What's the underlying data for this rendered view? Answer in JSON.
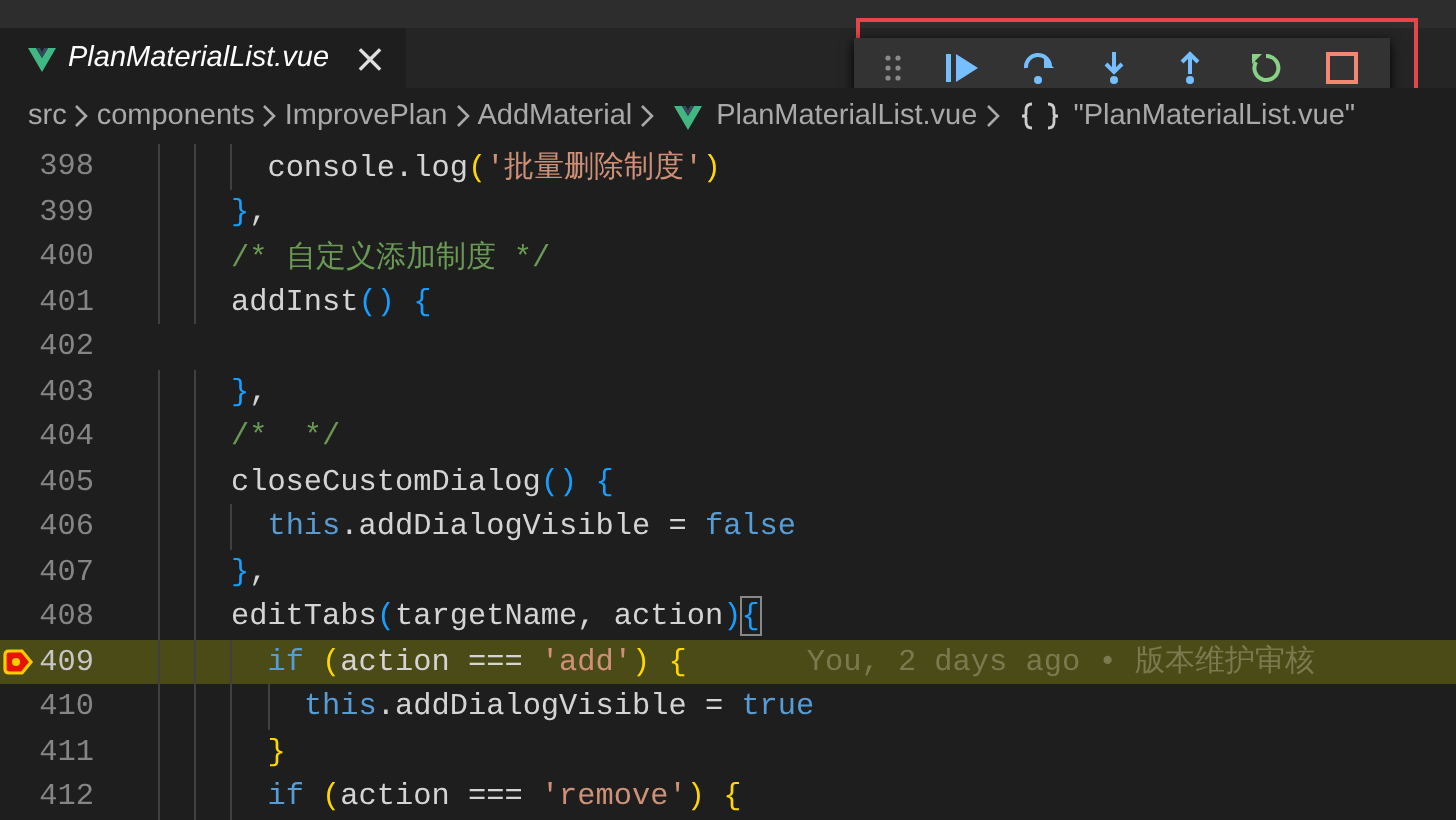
{
  "tabs": [
    {
      "label": "PlanMaterialList.vue",
      "selected": true,
      "preview": true,
      "close": "×"
    }
  ],
  "debug_toolbar": {
    "buttons": [
      {
        "kind": "gripper"
      },
      {
        "kind": "continue"
      },
      {
        "kind": "step_over"
      },
      {
        "kind": "step_into"
      },
      {
        "kind": "step_out"
      },
      {
        "kind": "restart"
      },
      {
        "kind": "stop"
      }
    ],
    "highlighted": true
  },
  "breadcrumbs": [
    {
      "kind": "folder",
      "label": "src"
    },
    {
      "kind": "folder",
      "label": "components"
    },
    {
      "kind": "folder",
      "label": "ImprovePlan"
    },
    {
      "kind": "folder",
      "label": "AddMaterial"
    },
    {
      "kind": "file",
      "label": "PlanMaterialList.vue"
    },
    {
      "kind": "symbol",
      "label": "\"PlanMaterialList.vue\""
    }
  ],
  "editor": {
    "lines": [
      {
        "number": "398",
        "tokens": [
          {
            "kind": "plain",
            "text": "      console.log"
          },
          {
            "kind": "bracket_gold",
            "text": "("
          },
          {
            "kind": "string",
            "text": "'批量删除制度'"
          },
          {
            "kind": "bracket_gold",
            "text": ")"
          }
        ]
      },
      {
        "number": "399",
        "tokens": [
          {
            "kind": "bracket_blue",
            "text": "    }"
          },
          {
            "kind": "plain",
            "text": ","
          }
        ]
      },
      {
        "number": "400",
        "tokens": [
          {
            "kind": "comment",
            "text": "    /* 自定义添加制度 */"
          }
        ]
      },
      {
        "number": "401",
        "tokens": [
          {
            "kind": "plain",
            "text": "    addInst"
          },
          {
            "kind": "bracket_blue",
            "text": "()"
          },
          {
            "kind": "bracket_blue",
            "text": " {"
          }
        ]
      },
      {
        "number": "402"
      },
      {
        "number": "403",
        "tokens": [
          {
            "kind": "bracket_blue",
            "text": "    }"
          },
          {
            "kind": "plain",
            "text": ","
          }
        ]
      },
      {
        "number": "404",
        "tokens": [
          {
            "kind": "comment",
            "text": "    /*  */"
          }
        ]
      },
      {
        "number": "405",
        "tokens": [
          {
            "kind": "plain",
            "text": "    closeCustomDialog"
          },
          {
            "kind": "bracket_blue",
            "text": "()"
          },
          {
            "kind": "bracket_blue",
            "text": " {"
          }
        ]
      },
      {
        "number": "406",
        "tokens": [
          {
            "kind": "keyword",
            "text": "      this"
          },
          {
            "kind": "plain",
            "text": ".addDialogVisible = "
          },
          {
            "kind": "keyword",
            "text": "false"
          }
        ]
      },
      {
        "number": "407",
        "tokens": [
          {
            "kind": "bracket_blue",
            "text": "    }"
          },
          {
            "kind": "plain",
            "text": ","
          }
        ]
      },
      {
        "number": "408",
        "tokens": [
          {
            "kind": "plain",
            "text": "    editTabs"
          },
          {
            "kind": "bracket_blue",
            "text": "("
          },
          {
            "kind": "plain",
            "text": "targetName, action"
          },
          {
            "kind": "bracket_blue",
            "text": ")"
          },
          {
            "kind": "bracket_match",
            "text": "{"
          }
        ]
      },
      {
        "number": "409",
        "current": true,
        "breakpoint": true,
        "blame": "You, 2 days ago • 版本维护审核",
        "tokens": [
          {
            "kind": "keyword",
            "text": "      if"
          },
          {
            "kind": "bracket_gold",
            "text": " ("
          },
          {
            "kind": "plain",
            "text": "action === "
          },
          {
            "kind": "string",
            "text": "'add'"
          },
          {
            "kind": "bracket_gold",
            "text": ")"
          },
          {
            "kind": "bracket_gold",
            "text": " {"
          }
        ]
      },
      {
        "number": "410",
        "tokens": [
          {
            "kind": "keyword",
            "text": "        this"
          },
          {
            "kind": "plain",
            "text": ".addDialogVisible = "
          },
          {
            "kind": "keyword",
            "text": "true"
          }
        ]
      },
      {
        "number": "411",
        "tokens": [
          {
            "kind": "bracket_gold",
            "text": "      }"
          }
        ]
      },
      {
        "number": "412",
        "tokens": [
          {
            "kind": "keyword",
            "text": "      if"
          },
          {
            "kind": "bracket_gold",
            "text": " ("
          },
          {
            "kind": "plain",
            "text": "action === "
          },
          {
            "kind": "string",
            "text": "'remove'"
          },
          {
            "kind": "bracket_gold",
            "text": ")"
          },
          {
            "kind": "bracket_gold",
            "text": " {"
          }
        ]
      }
    ]
  }
}
